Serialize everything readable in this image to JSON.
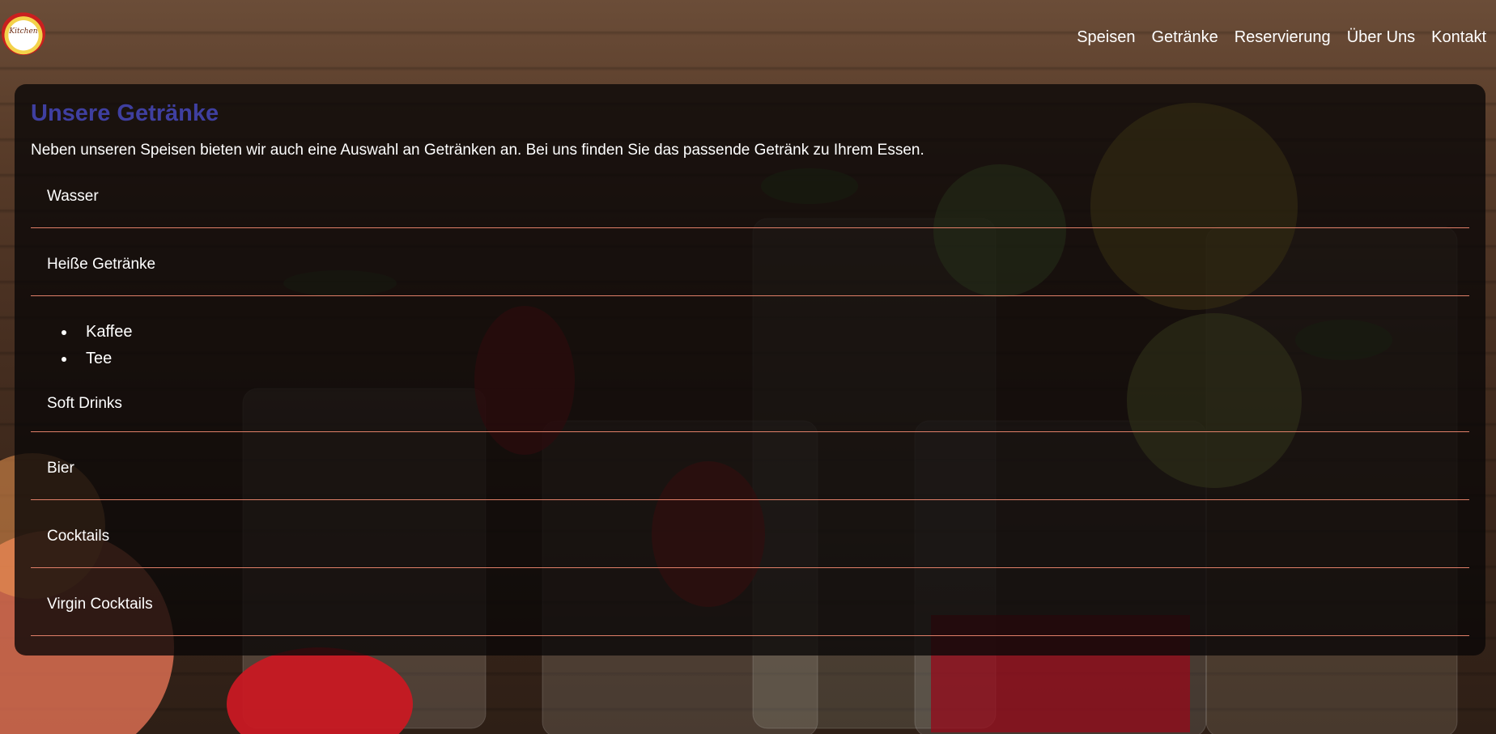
{
  "header": {
    "logo_text": "Kitchen",
    "nav": [
      {
        "label": "Speisen"
      },
      {
        "label": "Getränke"
      },
      {
        "label": "Reservierung"
      },
      {
        "label": "Über Uns"
      },
      {
        "label": "Kontakt"
      }
    ]
  },
  "panel": {
    "title": "Unsere Getränke",
    "intro": "Neben unseren Speisen bieten wir auch eine Auswahl an Getränken an. Bei uns finden Sie das passende Getränk zu Ihrem Essen.",
    "sections": [
      {
        "label": "Wasser"
      },
      {
        "label": "Heiße Getränke",
        "items": [
          "Kaffee",
          "Tee"
        ]
      },
      {
        "label": "Soft Drinks"
      },
      {
        "label": "Bier"
      },
      {
        "label": "Cocktails"
      },
      {
        "label": "Virgin Cocktails"
      }
    ]
  },
  "colors": {
    "title": "#3f3fa0",
    "divider": "#e07f68",
    "panel_bg": "rgba(10,8,8,0.80)"
  }
}
